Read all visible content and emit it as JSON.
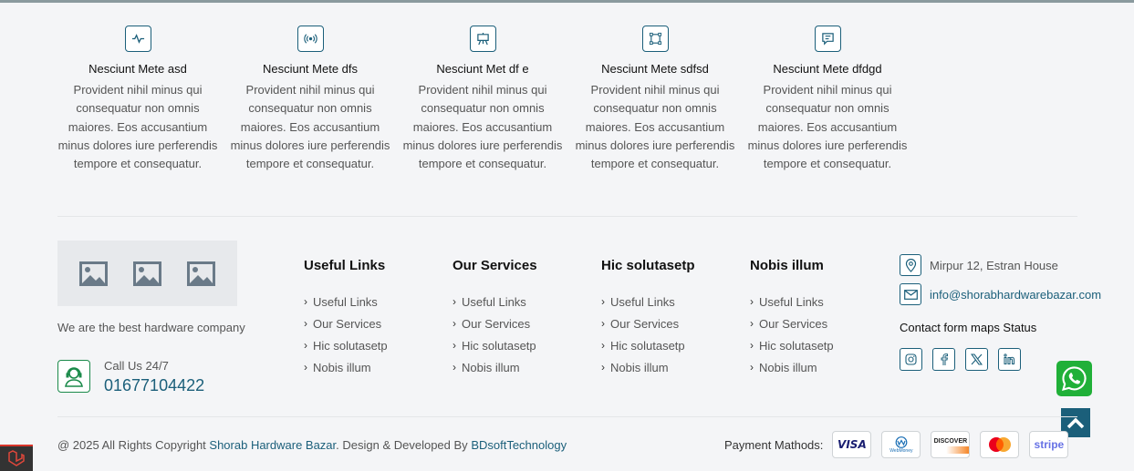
{
  "features": [
    {
      "icon": "activity-icon",
      "title": "Nesciunt Mete asd",
      "text": "Provident nihil minus qui consequatur non omnis maiores. Eos accusantium minus dolores iure perferendis tempore et consequatur."
    },
    {
      "icon": "broadcast-icon",
      "title": "Nesciunt Mete dfs",
      "text": "Provident nihil minus qui consequatur non omnis maiores. Eos accusantium minus dolores iure perferendis tempore et consequatur."
    },
    {
      "icon": "easel-icon",
      "title": "Nesciunt Met df e",
      "text": "Provident nihil minus qui consequatur non omnis maiores. Eos accusantium minus dolores iure perferendis tempore et consequatur."
    },
    {
      "icon": "bounding-box-icon",
      "title": "Nesciunt Mete sdfsd",
      "text": "Provident nihil minus qui consequatur non omnis maiores. Eos accusantium minus dolores iure perferendis tempore et consequatur."
    },
    {
      "icon": "chat-icon",
      "title": "Nesciunt Mete dfdgd",
      "text": "Provident nihil minus qui consequatur non omnis maiores. Eos accusantium minus dolores iure perferendis tempore et consequatur."
    }
  ],
  "brand": {
    "tagline": "We are the best hardware company",
    "call_label": "Call Us 24/7",
    "call_number": "01677104422"
  },
  "columns": [
    {
      "title": "Useful Links",
      "links": [
        "Useful Links",
        "Our Services",
        "Hic solutasetp",
        "Nobis illum"
      ]
    },
    {
      "title": "Our Services",
      "links": [
        "Useful Links",
        "Our Services",
        "Hic solutasetp",
        "Nobis illum"
      ]
    },
    {
      "title": "Hic solutasetp",
      "links": [
        "Useful Links",
        "Our Services",
        "Hic solutasetp",
        "Nobis illum"
      ]
    },
    {
      "title": "Nobis illum",
      "links": [
        "Useful Links",
        "Our Services",
        "Hic solutasetp",
        "Nobis illum"
      ]
    }
  ],
  "contact": {
    "address": "Mirpur 12, Estran House",
    "email": "info@shorabhardwarebazar.com",
    "status": "Contact form maps Status"
  },
  "socials": [
    "instagram-icon",
    "facebook-icon",
    "x-icon",
    "linkedin-icon"
  ],
  "footer": {
    "copyright_prefix": "@ 2025 All Rights Copyright",
    "company": "Shorab Hardware Bazar",
    "middle": ". Design & Developed By",
    "developer": "BDsoftTechnology",
    "payment_label": "Payment Mathods:",
    "cards": [
      "VISA",
      "WebMoney",
      "DISCOVER",
      "mastercard",
      "stripe"
    ]
  },
  "colors": {
    "accent": "#1b5f7a",
    "whatsapp": "#20b038",
    "background": "#f4f5f7"
  }
}
